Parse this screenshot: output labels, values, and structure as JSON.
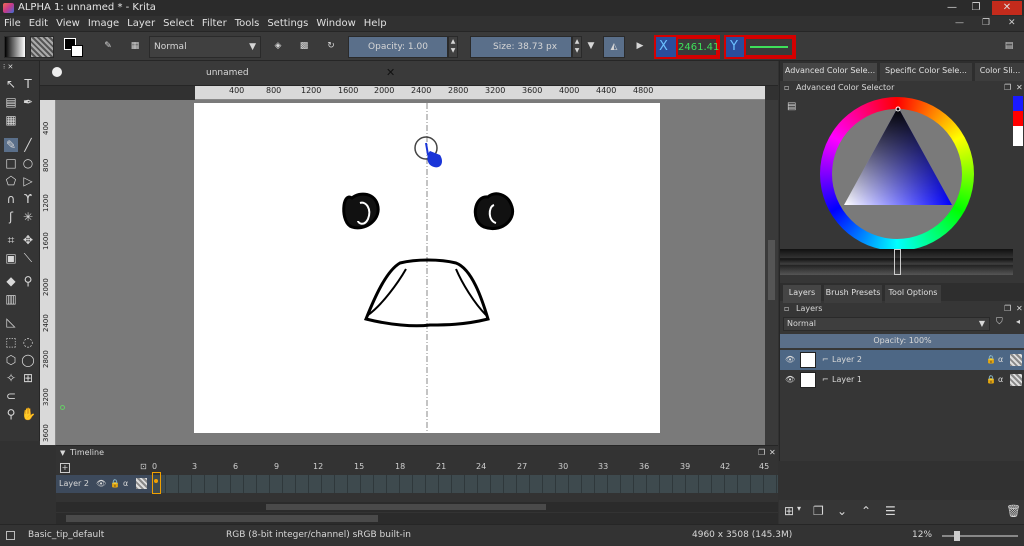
{
  "window": {
    "title": "ALPHA 1: unnamed * - Krita"
  },
  "menu": [
    "File",
    "Edit",
    "View",
    "Image",
    "Layer",
    "Select",
    "Filter",
    "Tools",
    "Settings",
    "Window",
    "Help"
  ],
  "toolbar": {
    "blend_mode": "Normal",
    "opacity_label": "Opacity:",
    "opacity_value": "1.00",
    "size_label": "Size:",
    "size_value": "38.73 px",
    "x_label": "X",
    "x_value": "2461.41",
    "y_label": "Y",
    "highlight_color": "#d40000"
  },
  "document": {
    "tab_title": "unnamed"
  },
  "ruler_h_ticks": [
    "400",
    "800",
    "1200",
    "1600",
    "2000",
    "2400",
    "2800",
    "3200",
    "3600",
    "4000",
    "4400",
    "4800"
  ],
  "ruler_v_ticks": [
    "400",
    "800",
    "1200",
    "1600",
    "2000",
    "2400",
    "2800",
    "3200",
    "3600"
  ],
  "dockers": {
    "top_tabs": [
      "Advanced Color Sele...",
      "Specific Color Sele...",
      "Color Sli..."
    ],
    "color_selector_title": "Advanced Color Selector",
    "bottom_tabs": [
      "Layers",
      "Brush Presets",
      "Tool Options"
    ],
    "layers_title": "Layers",
    "layers_blend": "Normal",
    "layers_opacity": "Opacity:  100%",
    "layers": [
      {
        "name": "Layer 2",
        "selected": true
      },
      {
        "name": "Layer 1",
        "selected": false
      }
    ]
  },
  "timeline": {
    "title": "Timeline",
    "frames": [
      "0",
      "3",
      "6",
      "9",
      "12",
      "15",
      "18",
      "21",
      "24",
      "27",
      "30",
      "33",
      "36",
      "39",
      "42",
      "45"
    ],
    "layer": "Layer 2"
  },
  "status": {
    "brush": "Basic_tip_default",
    "color_space": "RGB (8-bit integer/channel)  sRGB built-in",
    "dimensions": "4960 x 3508 (145.3M)",
    "zoom": "12%"
  }
}
